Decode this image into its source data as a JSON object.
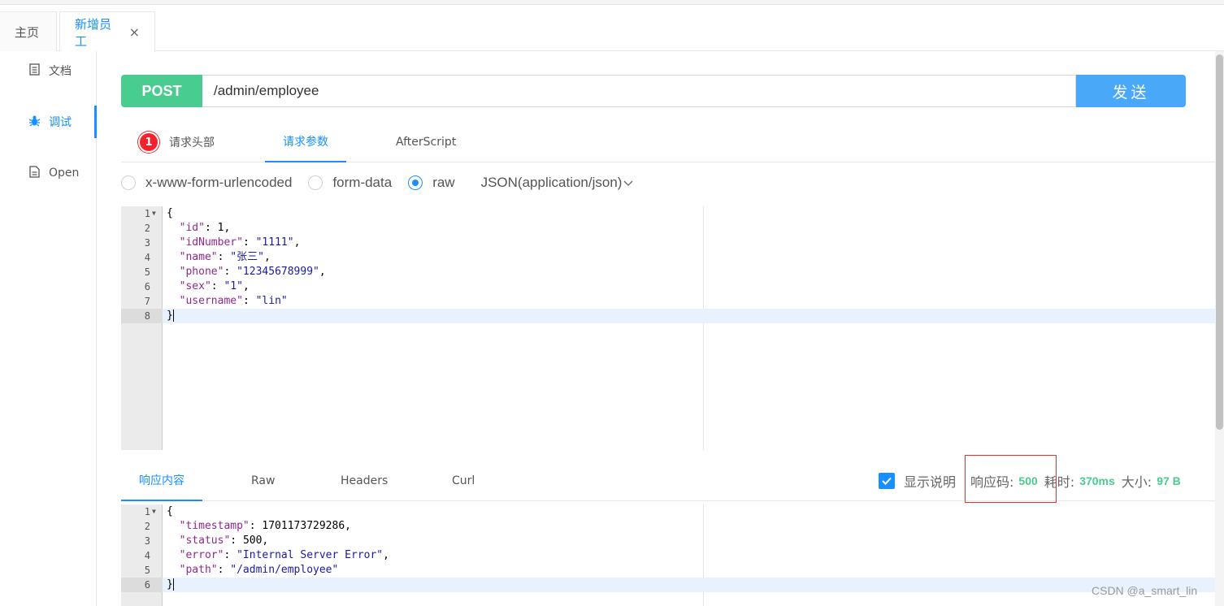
{
  "tabs": [
    {
      "label": "主页"
    },
    {
      "label": "新增员工",
      "close": "×"
    }
  ],
  "sidebar": {
    "items": [
      {
        "label": "文档",
        "icon": "document-icon"
      },
      {
        "label": "调试",
        "icon": "bug-icon"
      },
      {
        "label": "Open",
        "icon": "file-icon"
      }
    ]
  },
  "request": {
    "method": "POST",
    "url": "/admin/employee",
    "send_label": "发送"
  },
  "param_tabs": {
    "headers_badge": "1",
    "headers_label": "请求头部",
    "params_label": "请求参数",
    "afterscript_label": "AfterScript"
  },
  "body_types": {
    "urlencoded": "x-www-form-urlencoded",
    "formdata": "form-data",
    "raw": "raw",
    "content_type": "JSON(application/json)",
    "selected": "raw"
  },
  "request_body": [
    "{",
    "  \"id\": 1,",
    "  \"idNumber\": \"1111\",",
    "  \"name\": \"张三\",",
    "  \"phone\": \"12345678999\",",
    "  \"sex\": \"1\",",
    "  \"username\": \"lin\"",
    "}"
  ],
  "response_tabs": {
    "content": "响应内容",
    "raw": "Raw",
    "headers": "Headers",
    "curl": "Curl"
  },
  "response_status": {
    "show_desc_label": "显示说明",
    "code_label": "响应码:",
    "code": "500",
    "time_label": "耗时:",
    "time": "370ms",
    "size_label": "大小:",
    "size": "97 B"
  },
  "response_body": [
    "{",
    "  \"timestamp\": 1701173729286,",
    "  \"status\": 500,",
    "  \"error\": \"Internal Server Error\",",
    "  \"path\": \"/admin/employee\"",
    "}"
  ],
  "watermark": "CSDN @a_smart_lin",
  "colors": {
    "accent": "#1890ff",
    "post": "#49cc90",
    "send": "#4aa8f8",
    "badge": "#f5222d",
    "highlight_box": "#e03131"
  }
}
